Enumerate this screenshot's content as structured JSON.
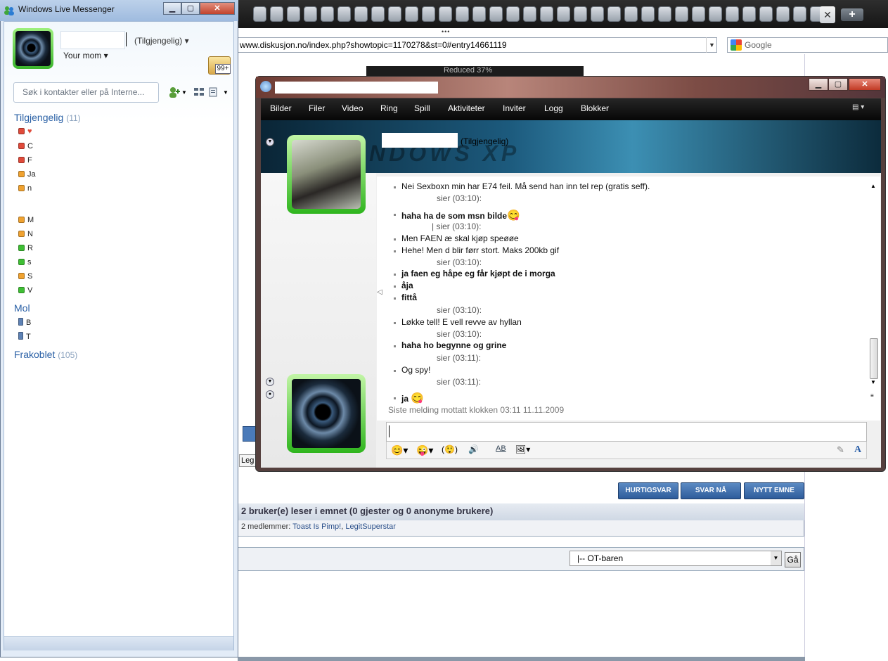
{
  "browser": {
    "tab_close": "✕",
    "tab_new": "+",
    "url": "www.diskusjon.no/index.php?showtopic=1170278&st=0#entry14661119",
    "url_dropdown": "▼",
    "search_placeholder": "Google",
    "image_caption": "Reduced 37%",
    "buttons": {
      "quick_reply": "HURTIGSVAR",
      "reply_now": "SVAR NÅ",
      "new_topic": "NYTT EMNE"
    },
    "readers_heading": "2 bruker(e) leser i emnet (0 gjester og 0 anonyme brukere)",
    "readers_members_label": "2 medlemmer:",
    "readers_member_1": "Toast Is Pimp!",
    "readers_sep": ",",
    "readers_member_2": "LegitSuperstar",
    "forum_jump_value": "|-- OT-baren",
    "go_button": "Gå",
    "left_peek_text": "Leg"
  },
  "messenger": {
    "title": "Windows Live Messenger",
    "caption_min": "▁",
    "caption_max": "▢",
    "caption_close": "✕",
    "status": "(Tilgjengelig)",
    "status_arrow": "▾",
    "personal_message": "Your mom",
    "mail_count": "99+",
    "search_placeholder": "Søk i kontakter eller på Interne...",
    "groups": [
      {
        "name": "Tilgjengelig",
        "count": "(11)"
      },
      {
        "name": "Mol",
        "count": ""
      },
      {
        "name": "Frakoblet",
        "count": "(105)"
      }
    ],
    "contacts_available": [
      "",
      "C",
      "F",
      "Ja",
      "n",
      "M",
      "N",
      "R",
      "s",
      "S",
      "V"
    ],
    "contacts_mobile": [
      "B",
      "T"
    ],
    "colors": {
      "accent": "#2b61a6",
      "online": "#3fbf34",
      "busy": "#e04a3a",
      "away": "#f0a230"
    }
  },
  "conversation": {
    "menu": [
      "Bilder",
      "Filer",
      "Video",
      "Ring",
      "Spill",
      "Aktiviteter",
      "Inviter",
      "Logg",
      "Blokker"
    ],
    "contact_status": "(Tilgjengelig)",
    "banner_watermark": "NDOWS XP",
    "messages": [
      {
        "kind": "msg",
        "text": "Nei Sexboxn min har E74 feil. Må send han inn tel rep (gratis seff)."
      },
      {
        "kind": "sender",
        "text": "sier (03:10):"
      },
      {
        "kind": "msg",
        "text": "haha ha de som msn bilde",
        "bold": true,
        "emoticon": "😋"
      },
      {
        "kind": "sender",
        "text": "| sier (03:10):"
      },
      {
        "kind": "msg",
        "text": "Men FAEN æ skal kjøp speøøe"
      },
      {
        "kind": "msg",
        "text": "Hehe! Men d blir førr stort. Maks 200kb gif"
      },
      {
        "kind": "sender",
        "text": "sier (03:10):"
      },
      {
        "kind": "msg",
        "text": "ja faen eg håpe eg får kjøpt de i morga",
        "bold": true
      },
      {
        "kind": "msg",
        "text": "åja",
        "bold": true
      },
      {
        "kind": "msg",
        "text": "fittå",
        "bold": true
      },
      {
        "kind": "sender",
        "text": "sier (03:10):"
      },
      {
        "kind": "msg",
        "text": "Løkke tell! E vell revve av hyllan"
      },
      {
        "kind": "sender",
        "text": "sier (03:10):"
      },
      {
        "kind": "msg",
        "text": "haha ho begynne og grine",
        "bold": true
      },
      {
        "kind": "sender",
        "text": "sier (03:11):"
      },
      {
        "kind": "msg",
        "text": "Og spy!"
      },
      {
        "kind": "sender",
        "text": "sier (03:11):"
      },
      {
        "kind": "msg",
        "text": "ja",
        "bold": true,
        "emoticon": "😋"
      }
    ],
    "last_message": "Siste melding mottatt klokken 03:11 11.11.2009",
    "toolbar": {
      "emoticons": "😊▾",
      "winks": "😜▾",
      "nudge": "(😲)",
      "voice": "🔊",
      "font_size": "AB",
      "background": "🖼▾",
      "font": "A"
    }
  }
}
